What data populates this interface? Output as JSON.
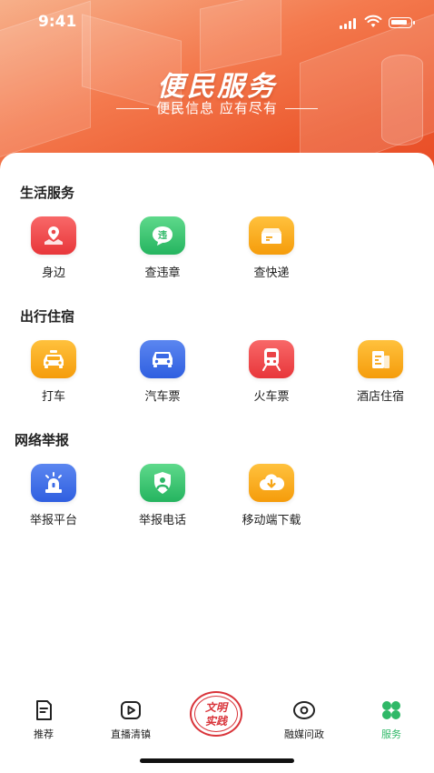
{
  "status_bar": {
    "time": "9:41"
  },
  "hero": {
    "title": "便民服务",
    "subtitle": "便民信息 应有尽有"
  },
  "sections": [
    {
      "title": "生活服务",
      "items": [
        {
          "label": "身边",
          "icon": "location-map-icon",
          "color": "red"
        },
        {
          "label": "查违章",
          "icon": "violation-chat-icon",
          "color": "green"
        },
        {
          "label": "查快递",
          "icon": "package-icon",
          "color": "orange"
        }
      ]
    },
    {
      "title": "出行住宿",
      "items": [
        {
          "label": "打车",
          "icon": "taxi-icon",
          "color": "orange"
        },
        {
          "label": "汽车票",
          "icon": "car-icon",
          "color": "blue"
        },
        {
          "label": "火车票",
          "icon": "train-icon",
          "color": "red"
        },
        {
          "label": "酒店住宿",
          "icon": "hotel-icon",
          "color": "orange"
        }
      ]
    },
    {
      "title": "网络举报",
      "items": [
        {
          "label": "举报平台",
          "icon": "alarm-siren-icon",
          "color": "blue"
        },
        {
          "label": "举报电话",
          "icon": "phone-shield-icon",
          "color": "green"
        },
        {
          "label": "移动端下载",
          "icon": "cloud-download-icon",
          "color": "orange"
        }
      ]
    }
  ],
  "icon_glyphs": {
    "violation": "违"
  },
  "tabbar": {
    "tabs": [
      {
        "label": "推荐",
        "icon": "document-icon",
        "active": false
      },
      {
        "label": "直播清镇",
        "icon": "play-icon",
        "active": false
      },
      {
        "label": "融媒问政",
        "icon": "eye-icon",
        "active": false
      },
      {
        "label": "服务",
        "icon": "clover-grid-icon",
        "active": true
      }
    ],
    "center": {
      "line1": "文明",
      "line2": "实践"
    }
  },
  "colors": {
    "hero_gradient": [
      "#f7b08a",
      "#e84a25"
    ],
    "active_tab": "#2fb867",
    "seal_red": "#d9343a"
  }
}
